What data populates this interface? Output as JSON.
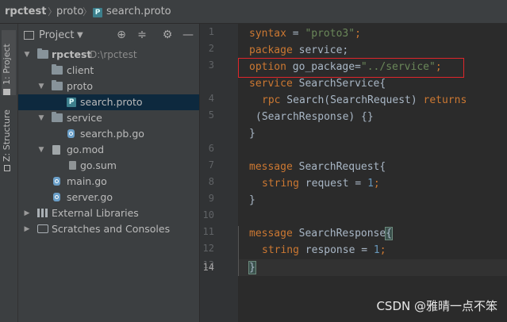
{
  "breadcrumb": {
    "project": "rpctest",
    "folder": "proto",
    "file": "search.proto",
    "file_icon": "P"
  },
  "left_strip": {
    "tab_project": "1: Project",
    "tab_structure": "Z: Structure"
  },
  "project_panel": {
    "title": "Project",
    "tree": [
      {
        "label": "rpctest",
        "sub": "D:\\rpctest",
        "type": "folder",
        "bold": true
      },
      {
        "label": "client",
        "type": "folder"
      },
      {
        "label": "proto",
        "type": "folder"
      },
      {
        "label": "search.proto",
        "type": "proto",
        "selected": true
      },
      {
        "label": "service",
        "type": "folder"
      },
      {
        "label": "search.pb.go",
        "type": "go"
      },
      {
        "label": "go.mod",
        "type": "mod"
      },
      {
        "label": "go.sum",
        "type": "sum"
      },
      {
        "label": "main.go",
        "type": "go"
      },
      {
        "label": "server.go",
        "type": "go"
      },
      {
        "label": "External Libraries",
        "type": "lib"
      },
      {
        "label": "Scratches and Consoles",
        "type": "scratch"
      }
    ]
  },
  "editor": {
    "line_numbers": [
      "1",
      "2",
      "3",
      "",
      "4",
      "5",
      "",
      "6",
      "7",
      "8",
      "9",
      "10",
      "11",
      "12",
      "13",
      "14"
    ],
    "current_line": "14",
    "code": {
      "l1_kw": "syntax",
      "l1_eq": " = ",
      "l1_str": "\"proto3\"",
      "l1_end": ";",
      "l2_kw": "package",
      "l2_id": " service;",
      "l3_kw": "option",
      "l3_id": " go_package=",
      "l3_str": "\"../service\"",
      "l3_end": ";",
      "l4_kw": "service",
      "l4_id": " SearchService{",
      "l5_kw": "rpc",
      "l5_id": " Search(SearchRequest) ",
      "l5_kw2": "returns",
      "l5b_id": "(SearchResponse) {}",
      "l6_id": "}",
      "l8_kw": "message",
      "l8_id": " SearchRequest{",
      "l9_kw": "string",
      "l9_id": " request = ",
      "l9_num": "1",
      "l9_end": ";",
      "l10_id": "}",
      "l12_kw": "message",
      "l12_id": " SearchResponse",
      "l12_brace": "{",
      "l13_kw": "string",
      "l13_id": " response = ",
      "l13_num": "1",
      "l13_end": ";",
      "l14_brace": "}"
    }
  },
  "watermark": "CSDN @雅晴一点不笨",
  "colors": {
    "keyword": "#cc7832",
    "string": "#6a8759",
    "number": "#6897bb",
    "identifier": "#a9b7c6",
    "highlight_box": "#e0262b",
    "selection": "#0d293e"
  }
}
